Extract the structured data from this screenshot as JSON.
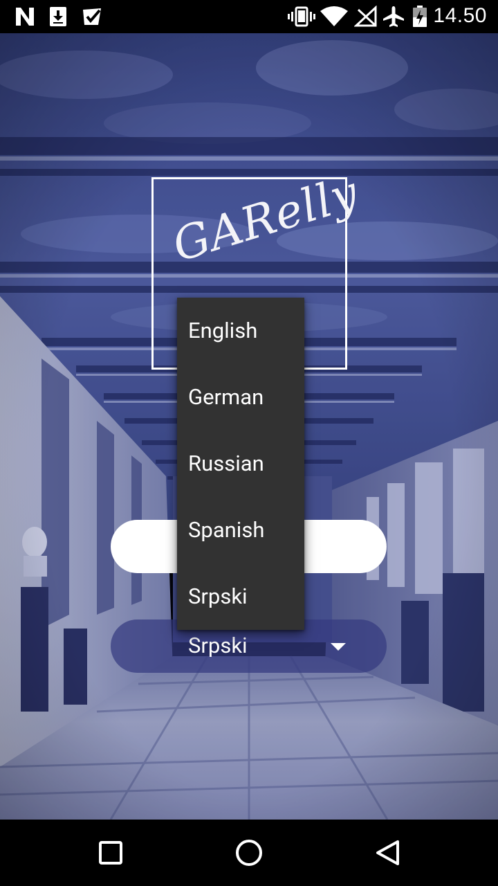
{
  "status_bar": {
    "time": "14.50",
    "left_icons": [
      "n-notification-icon",
      "download-icon",
      "check-badge-icon"
    ],
    "right_icons": [
      "vibrate-icon",
      "wifi-icon",
      "no-signal-icon",
      "airplane-mode-icon",
      "battery-icon"
    ]
  },
  "logo": {
    "text": "GARelly"
  },
  "language_spinner": {
    "selected": "Srpski",
    "arrow_icon": "dropdown-arrow-icon"
  },
  "language_dropdown": {
    "options": [
      "English",
      "German",
      "Russian",
      "Spanish",
      "Srpski"
    ]
  },
  "nav_bar": {
    "buttons": [
      "recents-button",
      "home-button",
      "back-button"
    ]
  },
  "colors": {
    "status_bar_bg": "#000000",
    "dropdown_bg": "#323232",
    "spinner_bg": "#343a80",
    "pill_bg": "#ffffff"
  }
}
